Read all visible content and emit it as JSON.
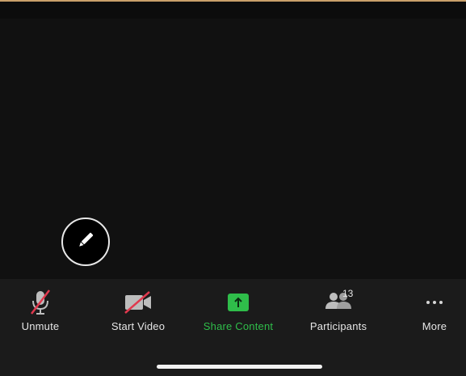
{
  "toolbar": {
    "items": [
      {
        "key": "unmute",
        "label": "Unmute",
        "icon": "muted-microphone-icon"
      },
      {
        "key": "start_video",
        "label": "Start Video",
        "icon": "video-off-icon"
      },
      {
        "key": "share_content",
        "label": "Share Content",
        "icon": "share-screen-icon"
      },
      {
        "key": "participants",
        "label": "Participants",
        "icon": "participants-icon",
        "count": "13"
      },
      {
        "key": "more",
        "label": "More",
        "icon": "more-dots-icon"
      }
    ]
  },
  "stage": {
    "annotate_icon": "pencil-icon"
  },
  "colors": {
    "share_accent": "#2fbd4a",
    "muted_slash": "#e0394e",
    "toolbar_bg": "#1b1b1b",
    "stage_bg": "#111111"
  }
}
